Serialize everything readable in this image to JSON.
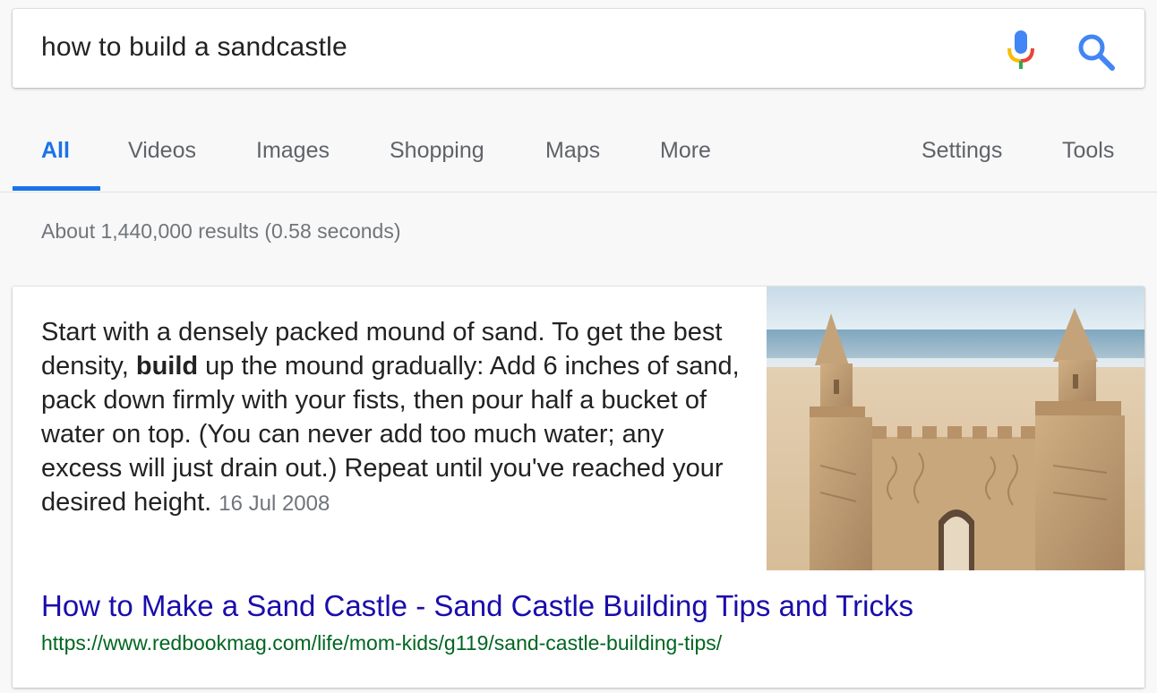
{
  "search": {
    "query": "how to build a sandcastle",
    "mic_icon": "microphone-icon",
    "search_icon": "magnifier-icon"
  },
  "tabs": [
    {
      "label": "All",
      "active": true
    },
    {
      "label": "Videos"
    },
    {
      "label": "Images"
    },
    {
      "label": "Shopping"
    },
    {
      "label": "Maps"
    },
    {
      "label": "More"
    },
    {
      "label": "Settings"
    },
    {
      "label": "Tools"
    }
  ],
  "result_stats": "About 1,440,000 results (0.58 seconds)",
  "featured_snippet": {
    "text_before": "Start with a densely packed mound of sand. To get the best density, ",
    "bold_word": "build",
    "text_after": " up the mound gradually: Add 6 inches of sand, pack down firmly with your fists, then pour half a bucket of water on top. (You can never add too much water; any excess will just drain out.) Repeat until you've reached your desired height.",
    "date": "16 Jul 2008",
    "image": "sandcastle-photo",
    "title": "How to Make a Sand Castle - Sand Castle Building Tips and Tricks",
    "url": "https://www.redbookmag.com/life/mom-kids/g119/sand-castle-building-tips/"
  },
  "colors": {
    "accent": "#1a73e8",
    "link": "#1a0dab",
    "url": "#006621"
  }
}
